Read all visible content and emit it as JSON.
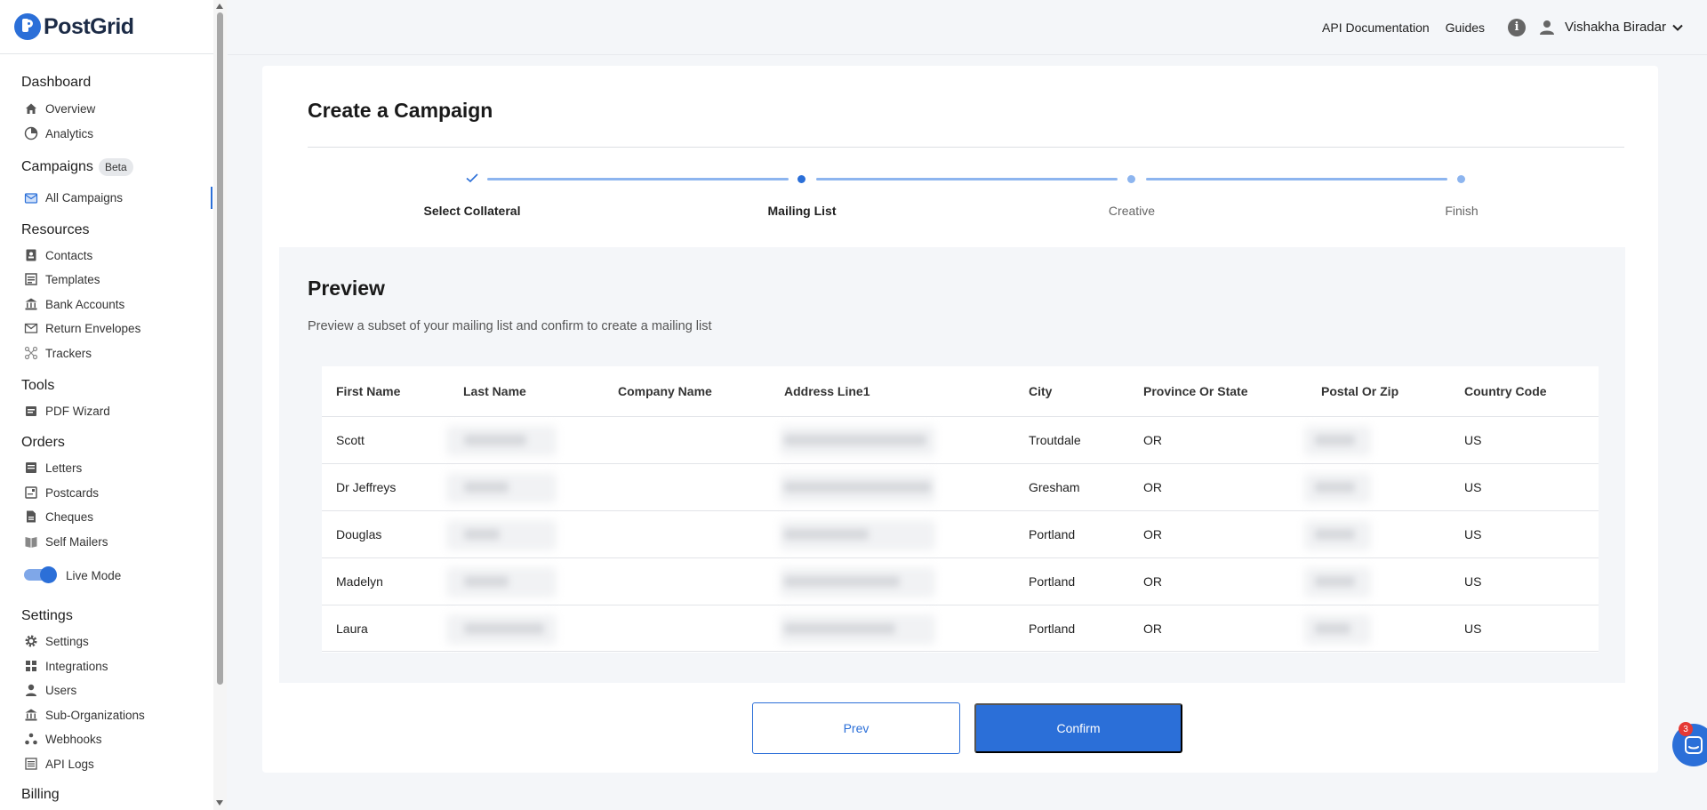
{
  "brand": {
    "name": "PostGrid"
  },
  "colors": {
    "accent": "#2b6fd8",
    "step_light": "#8db5ef"
  },
  "sidebar": {
    "sections": {
      "dashboard": "Dashboard",
      "campaigns": "Campaigns",
      "campaigns_badge": "Beta",
      "resources": "Resources",
      "tools": "Tools",
      "orders": "Orders",
      "settings": "Settings",
      "billing": "Billing"
    },
    "items": {
      "overview": "Overview",
      "analytics": "Analytics",
      "all_campaigns": "All Campaigns",
      "contacts": "Contacts",
      "templates": "Templates",
      "bank_accounts": "Bank Accounts",
      "return_envelopes": "Return Envelopes",
      "trackers": "Trackers",
      "pdf_wizard": "PDF Wizard",
      "letters": "Letters",
      "postcards": "Postcards",
      "cheques": "Cheques",
      "self_mailers": "Self Mailers",
      "settings": "Settings",
      "integrations": "Integrations",
      "users": "Users",
      "sub_organizations": "Sub-Organizations",
      "webhooks": "Webhooks",
      "api_logs": "API Logs"
    },
    "live_mode": {
      "label": "Live Mode",
      "on": true
    }
  },
  "topbar": {
    "api_docs": "API Documentation",
    "guides": "Guides",
    "info": "i",
    "user_name": "Vishakha Biradar"
  },
  "card": {
    "title": "Create a Campaign"
  },
  "stepper": {
    "steps": [
      {
        "label": "Select Collateral",
        "state": "complete"
      },
      {
        "label": "Mailing List",
        "state": "current"
      },
      {
        "label": "Creative",
        "state": "pending"
      },
      {
        "label": "Finish",
        "state": "pending"
      }
    ]
  },
  "preview": {
    "title": "Preview",
    "subtitle": "Preview a subset of your mailing list and confirm to create a mailing list",
    "columns": [
      "First Name",
      "Last Name",
      "Company Name",
      "Address Line1",
      "City",
      "Province Or State",
      "Postal Or Zip",
      "Country Code"
    ],
    "rows": [
      {
        "first_name": "Scott",
        "city": "Troutdale",
        "state": "OR",
        "country": "US"
      },
      {
        "first_name": "Dr Jeffreys",
        "city": "Gresham",
        "state": "OR",
        "country": "US"
      },
      {
        "first_name": "Douglas",
        "city": "Portland",
        "state": "OR",
        "country": "US"
      },
      {
        "first_name": "Madelyn",
        "city": "Portland",
        "state": "OR",
        "country": "US"
      },
      {
        "first_name": "Laura",
        "city": "Portland",
        "state": "OR",
        "country": "US"
      }
    ]
  },
  "actions": {
    "prev": "Prev",
    "confirm": "Confirm"
  },
  "chat": {
    "badge_count": "3"
  }
}
